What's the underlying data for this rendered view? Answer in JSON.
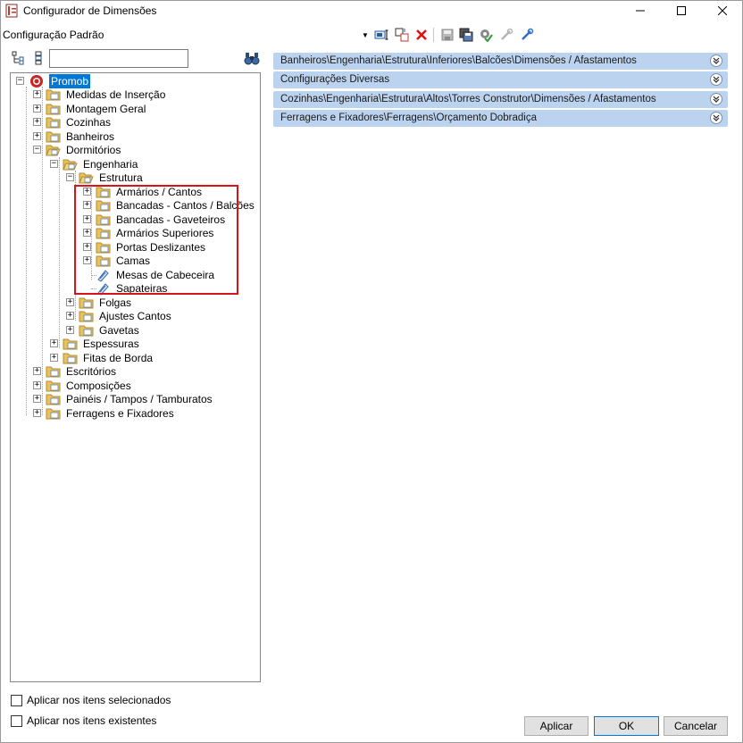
{
  "window": {
    "title": "Configurador de Dimensões"
  },
  "toolbar": {
    "configuration_label": "Configuração Padrão"
  },
  "search": {
    "value": "",
    "placeholder": ""
  },
  "tree": {
    "root": "Promob",
    "nodes": [
      {
        "label": "Medidas de Inserção"
      },
      {
        "label": "Montagem Geral"
      },
      {
        "label": "Cozinhas"
      },
      {
        "label": "Banheiros"
      },
      {
        "label": "Dormitórios"
      },
      {
        "label": "Engenharia"
      },
      {
        "label": "Estrutura"
      },
      {
        "label": "Armários / Cantos"
      },
      {
        "label": "Bancadas - Cantos / Balcões"
      },
      {
        "label": "Bancadas - Gaveteiros"
      },
      {
        "label": "Armários Superiores"
      },
      {
        "label": "Portas Deslizantes"
      },
      {
        "label": "Camas"
      },
      {
        "label": "Mesas de Cabeceira"
      },
      {
        "label": "Sapateiras"
      },
      {
        "label": "Folgas"
      },
      {
        "label": "Ajustes Cantos"
      },
      {
        "label": "Gavetas"
      },
      {
        "label": "Espessuras"
      },
      {
        "label": "Fitas de Borda"
      },
      {
        "label": "Escritórios"
      },
      {
        "label": "Composições"
      },
      {
        "label": "Painéis / Tampos / Tamburatos"
      },
      {
        "label": "Ferragens e Fixadores"
      }
    ]
  },
  "sections": [
    {
      "label": "Banheiros\\Engenharia\\Estrutura\\Inferiores\\Balcões\\Dimensões / Afastamentos"
    },
    {
      "label": "Configurações Diversas"
    },
    {
      "label": "Cozinhas\\Engenharia\\Estrutura\\Altos\\Torres Construtor\\Dimensões / Afastamentos"
    },
    {
      "label": "Ferragens e Fixadores\\Ferragens\\Orçamento Dobradiça"
    }
  ],
  "options": {
    "apply_selected": "Aplicar nos itens selecionados",
    "apply_existing": "Aplicar nos itens existentes"
  },
  "buttons": {
    "apply": "Aplicar",
    "ok": "OK",
    "cancel": "Cancelar"
  },
  "colors": {
    "section_bg": "#bcd3ef",
    "highlight": "#d7141a",
    "selection": "#0078d7",
    "folder": "#e8c25a"
  }
}
